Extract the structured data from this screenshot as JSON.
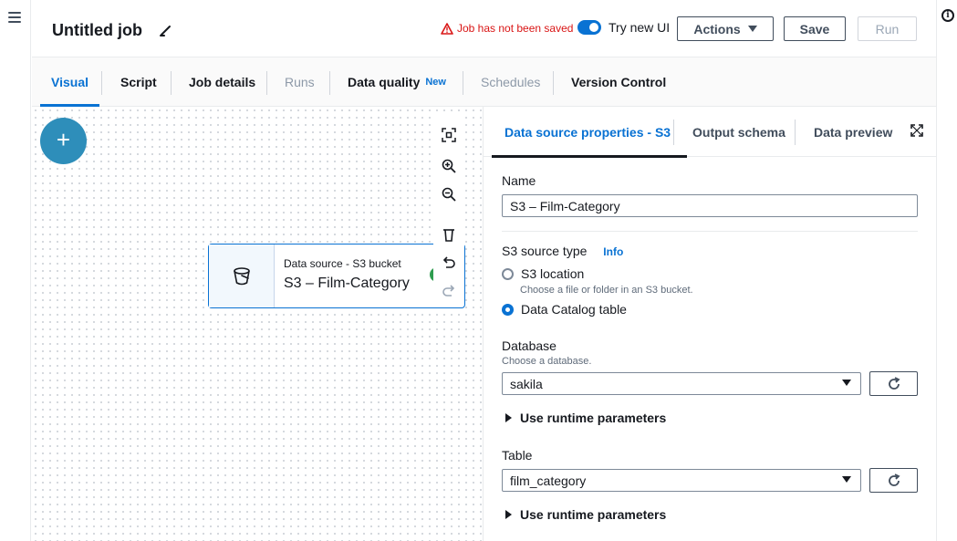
{
  "header": {
    "job_title": "Untitled job",
    "warning_text": "Job has not been saved",
    "toggle_label": "Try new UI",
    "actions_label": "Actions",
    "save_label": "Save",
    "run_label": "Run"
  },
  "tabs": [
    {
      "label": "Visual"
    },
    {
      "label": "Script"
    },
    {
      "label": "Job details"
    },
    {
      "label": "Runs"
    },
    {
      "label": "Data quality",
      "badge": "New"
    },
    {
      "label": "Schedules"
    },
    {
      "label": "Version Control"
    }
  ],
  "canvas": {
    "add_symbol": "+",
    "node": {
      "type_label": "Data source - S3 bucket",
      "name": "S3 – Film-Category",
      "icon": "bucket-icon"
    },
    "tools": [
      "fit-view-icon",
      "zoom-in-icon",
      "zoom-out-icon",
      "delete-icon",
      "undo-icon",
      "redo-icon"
    ]
  },
  "panel": {
    "tabs": [
      {
        "label": "Data source properties - S3"
      },
      {
        "label": "Output schema"
      },
      {
        "label": "Data preview"
      }
    ],
    "name_label": "Name",
    "name_value": "S3 – Film-Category",
    "source_type_label": "S3 source type",
    "info_link": "Info",
    "radio_s3_location": "S3 location",
    "radio_s3_location_hint": "Choose a file or folder in an S3 bucket.",
    "radio_catalog": "Data Catalog table",
    "database_label": "Database",
    "database_hint": "Choose a database.",
    "database_value": "sakila",
    "runtime_params": "Use runtime parameters",
    "table_label": "Table",
    "table_value": "film_category",
    "runtime_params_2": "Use runtime parameters"
  },
  "colors": {
    "accent": "#0972d3",
    "warning": "#d91515",
    "add_button": "#2e8eba",
    "status_green": "#2e9d4f"
  }
}
